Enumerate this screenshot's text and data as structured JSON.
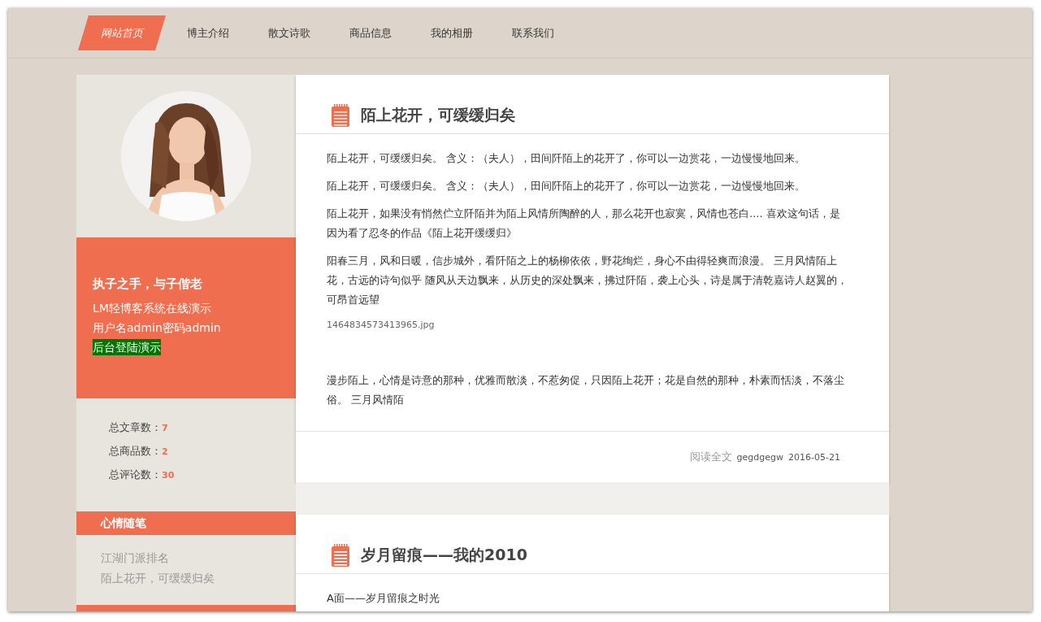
{
  "nav": [
    {
      "label": "网站首页",
      "selected": true
    },
    {
      "label": "博主介绍",
      "selected": false
    },
    {
      "label": "散文诗歌",
      "selected": false
    },
    {
      "label": "商品信息",
      "selected": false
    },
    {
      "label": "我的相册",
      "selected": false
    },
    {
      "label": "联系我们",
      "selected": false
    }
  ],
  "profile": {
    "avatar": {
      "kind": "picture"
    },
    "motto": "执子之手，与子偕老",
    "lines": [
      "LM轻博客系统在线演示",
      "用户名admin密码admin"
    ],
    "admin_link": "后台登陆演示"
  },
  "stats": [
    {
      "label": "总文章数：",
      "value": "7"
    },
    {
      "label": "总商品数：",
      "value": "2"
    },
    {
      "label": "总评论数：",
      "value": "30"
    }
  ],
  "sections": [
    {
      "kind": "list",
      "title": "心情随笔",
      "items": [
        "江湖门派排名",
        "陌上花开，可缓缓归矣"
      ]
    },
    {
      "kind": "header"
    }
  ],
  "posts": [
    {
      "title": "陌上花开，可缓缓归矣",
      "paragraphs": [
        "陌上花开，可缓缓归矣。 含义：（夫人），田间阡陌上的花开了，你可以一边赏花，一边慢慢地回来。",
        "陌上花开，可缓缓归矣。 含义：（夫人），田间阡陌上的花开了，你可以一边赏花，一边慢慢地回来。",
        "陌上花开，如果没有悄然伫立阡陌并为陌上风情所陶醉的人，那么花开也寂寞，风情也苍白.... 喜欢这句话，是因为看了忍冬的作品《陌上花开缓缓归》",
        "阳春三月，风和日暖，信步城外，看阡陌之上的杨柳依依，野花绚烂，身心不由得轻爽而浪漫。 三月风情陌上花，古远的诗句似乎 随风从天边飘来，从历史的深处飘来，拂过阡陌，袭上心头，诗是属于清乾嘉诗人赵翼的，可昂首远望"
      ],
      "image_file": "1464834573413965.jpg",
      "after": [
        "漫步陌上，心情是诗意的那种，优雅而散淡，不惹匆促，只因陌上花开；花是自然的那种，朴素而恬淡，不落尘俗。 三月风情陌"
      ],
      "read_more": "阅读全文",
      "author": "gegdgegw",
      "date": "2016-05-21"
    },
    {
      "title": "岁月留痕——我的2010",
      "paragraphs": [
        "A面——岁月留痕之时光"
      ]
    }
  ]
}
